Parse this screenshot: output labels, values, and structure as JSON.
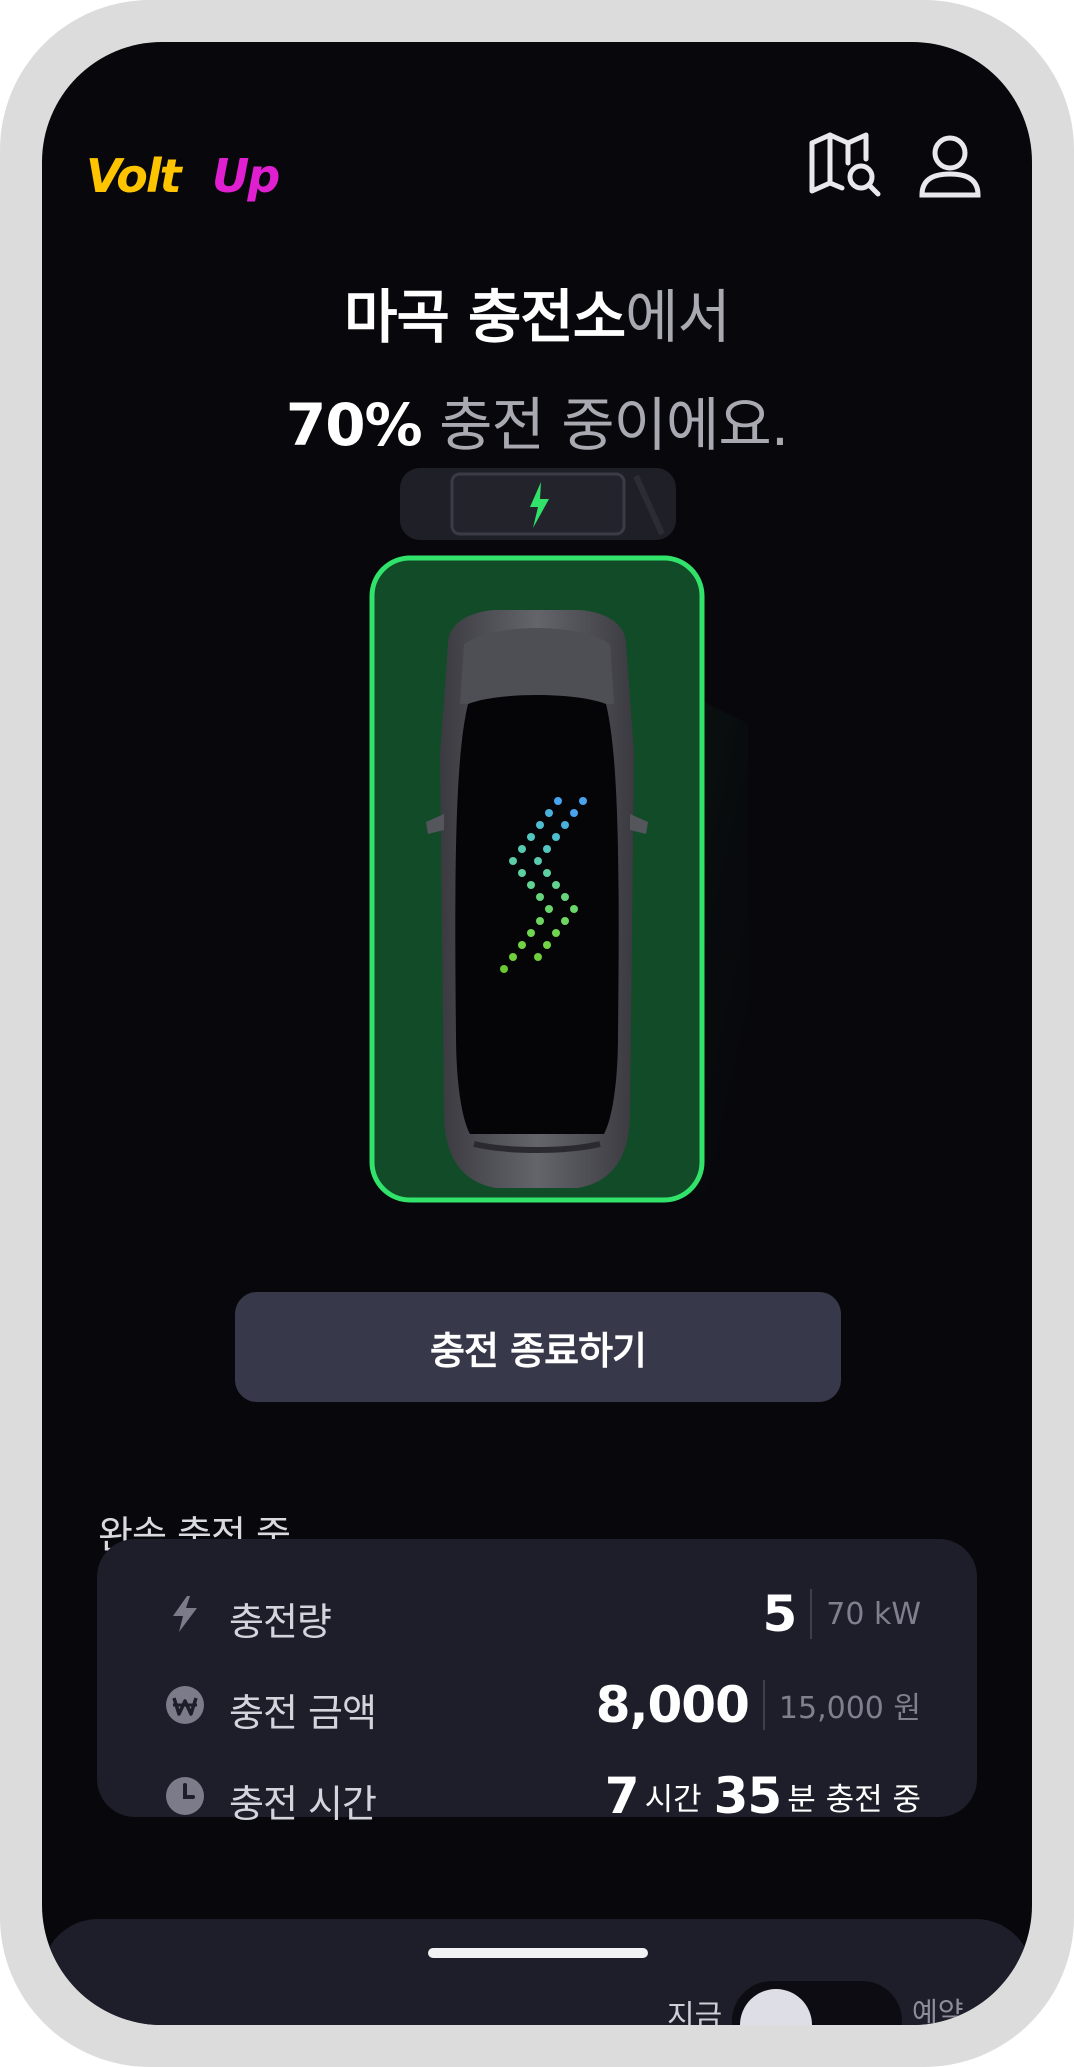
{
  "app": {
    "logo_text": "VoltUp",
    "brand_colors": {
      "volt": "#ffc400",
      "up": "#e020d0"
    }
  },
  "header": {
    "map_icon": "map-search-icon",
    "user_icon": "user-icon"
  },
  "title": {
    "station_name": "마곡 충전소",
    "station_suffix": "에서",
    "percent": "70%",
    "status_suffix": " 충전 중이에요."
  },
  "charging": {
    "progress": 0.7,
    "accent_color": "#31e36a",
    "bolt_icon": "lightning-bolt-icon"
  },
  "stop_button": {
    "label": "충전 종료하기"
  },
  "status_label": "완속 충전 중",
  "stats": {
    "amount": {
      "icon": "lightning-icon",
      "label": "충전량",
      "value": "5",
      "total": "70 kW"
    },
    "cost": {
      "icon": "won-coin-icon",
      "label": "충전 금액",
      "value": "8,000",
      "total": "15,000 원"
    },
    "time": {
      "icon": "clock-icon",
      "label": "충전 시간",
      "hours": "7",
      "hours_unit": "시간",
      "minutes": "35",
      "minutes_unit": "분 충전 중"
    }
  },
  "bottom_sheet": {
    "now_label": "지금",
    "reserve_label": "예약"
  }
}
